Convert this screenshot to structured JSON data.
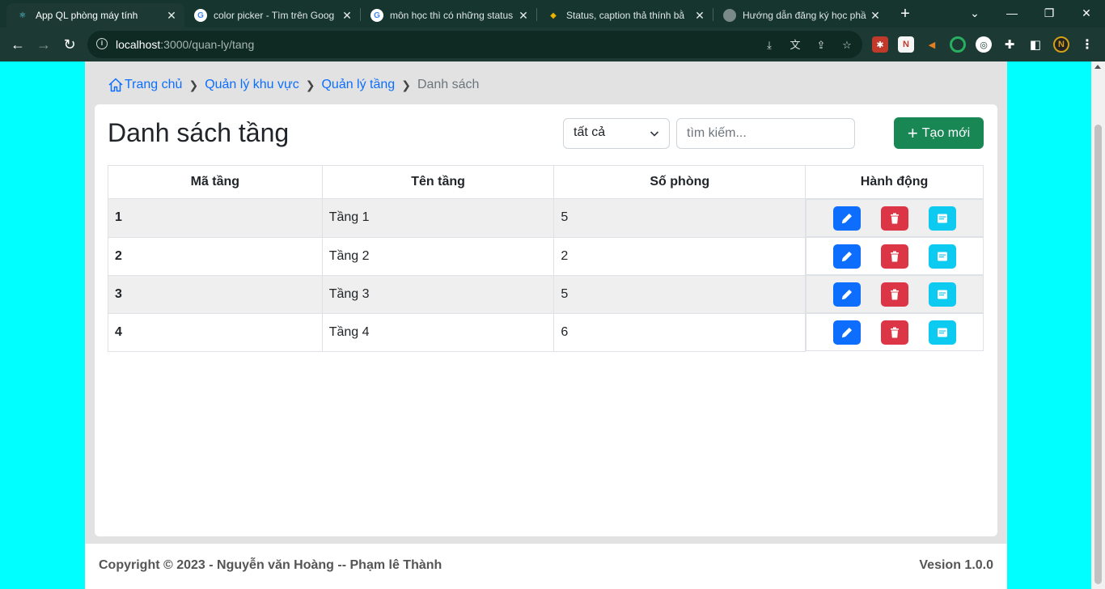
{
  "browser": {
    "tabs": [
      {
        "title": "App QL phòng máy tính",
        "icon": "react-icon"
      },
      {
        "title": "color picker - Tìm trên Goog",
        "icon": "google-icon"
      },
      {
        "title": "môn học thì có những status",
        "icon": "google-icon"
      },
      {
        "title": "Status, caption thả thính bằ",
        "icon": "site-icon"
      },
      {
        "title": "Hướng dẫn đăng ký học phầ",
        "icon": "globe-icon"
      }
    ],
    "url_host": "localhost",
    "url_rest": ":3000/quan-ly/tang"
  },
  "breadcrumb": {
    "home": "Trang chủ",
    "area": "Quản lý khu vực",
    "floor": "Quản lý tầng",
    "current": "Danh sách"
  },
  "page": {
    "title": "Danh sách tầng",
    "filter_value": "tất cả",
    "search_placeholder": "tìm kiếm...",
    "create_label": "Tạo mới"
  },
  "table": {
    "headers": [
      "Mã tầng",
      "Tên tầng",
      "Số phòng",
      "Hành động"
    ],
    "rows": [
      {
        "id": "1",
        "name": "Tầng 1",
        "rooms": "5"
      },
      {
        "id": "2",
        "name": "Tầng 2",
        "rooms": "2"
      },
      {
        "id": "3",
        "name": "Tầng 3",
        "rooms": "5"
      },
      {
        "id": "4",
        "name": "Tầng 4",
        "rooms": "6"
      }
    ]
  },
  "footer": {
    "copyright": "Copyright © 2023 - Nguyễn văn Hoàng -- Phạm lê Thành",
    "version": "Vesion 1.0.0"
  },
  "colors": {
    "create": "#198754",
    "edit": "#0d6efd",
    "delete": "#dc3545",
    "detail": "#0dcaf0",
    "link": "#0d6efd",
    "page_bg": "#00ffff"
  }
}
